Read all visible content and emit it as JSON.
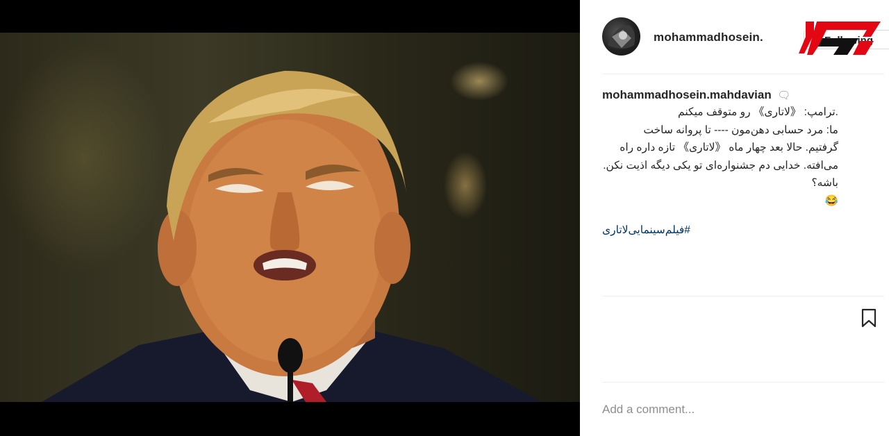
{
  "post": {
    "username": "mohammadhosein.mahdavian",
    "header_username": "mohammadhosein.",
    "follow_label": "Following",
    "caption_lines": [
      ".ترامپ: 《لاتاری》 رو متوقف میکنم",
      "ما: مرد حسابی دهن‌مون ---- تا پروانه ساخت",
      "گرفتیم. حالا بعد چهار ماه 《لاتاری》 تازه داره راه",
      "می‌افته. خدایی دم جشنواره‌ای تو یکی دیگه اذیت نکن.",
      "باشه؟",
      "😂"
    ],
    "hashtag": "#فیلم‌سینمایی‌لاتاری",
    "comment_placeholder": "Add a comment..."
  },
  "icons": {
    "bookmark": "bookmark-icon",
    "emoji": "face-icon",
    "logo": "brand-logo"
  },
  "colors": {
    "logo_red": "#e30613",
    "hashtag_blue": "#003569",
    "text_dark": "#262626",
    "placeholder_gray": "#8e8e8e"
  }
}
